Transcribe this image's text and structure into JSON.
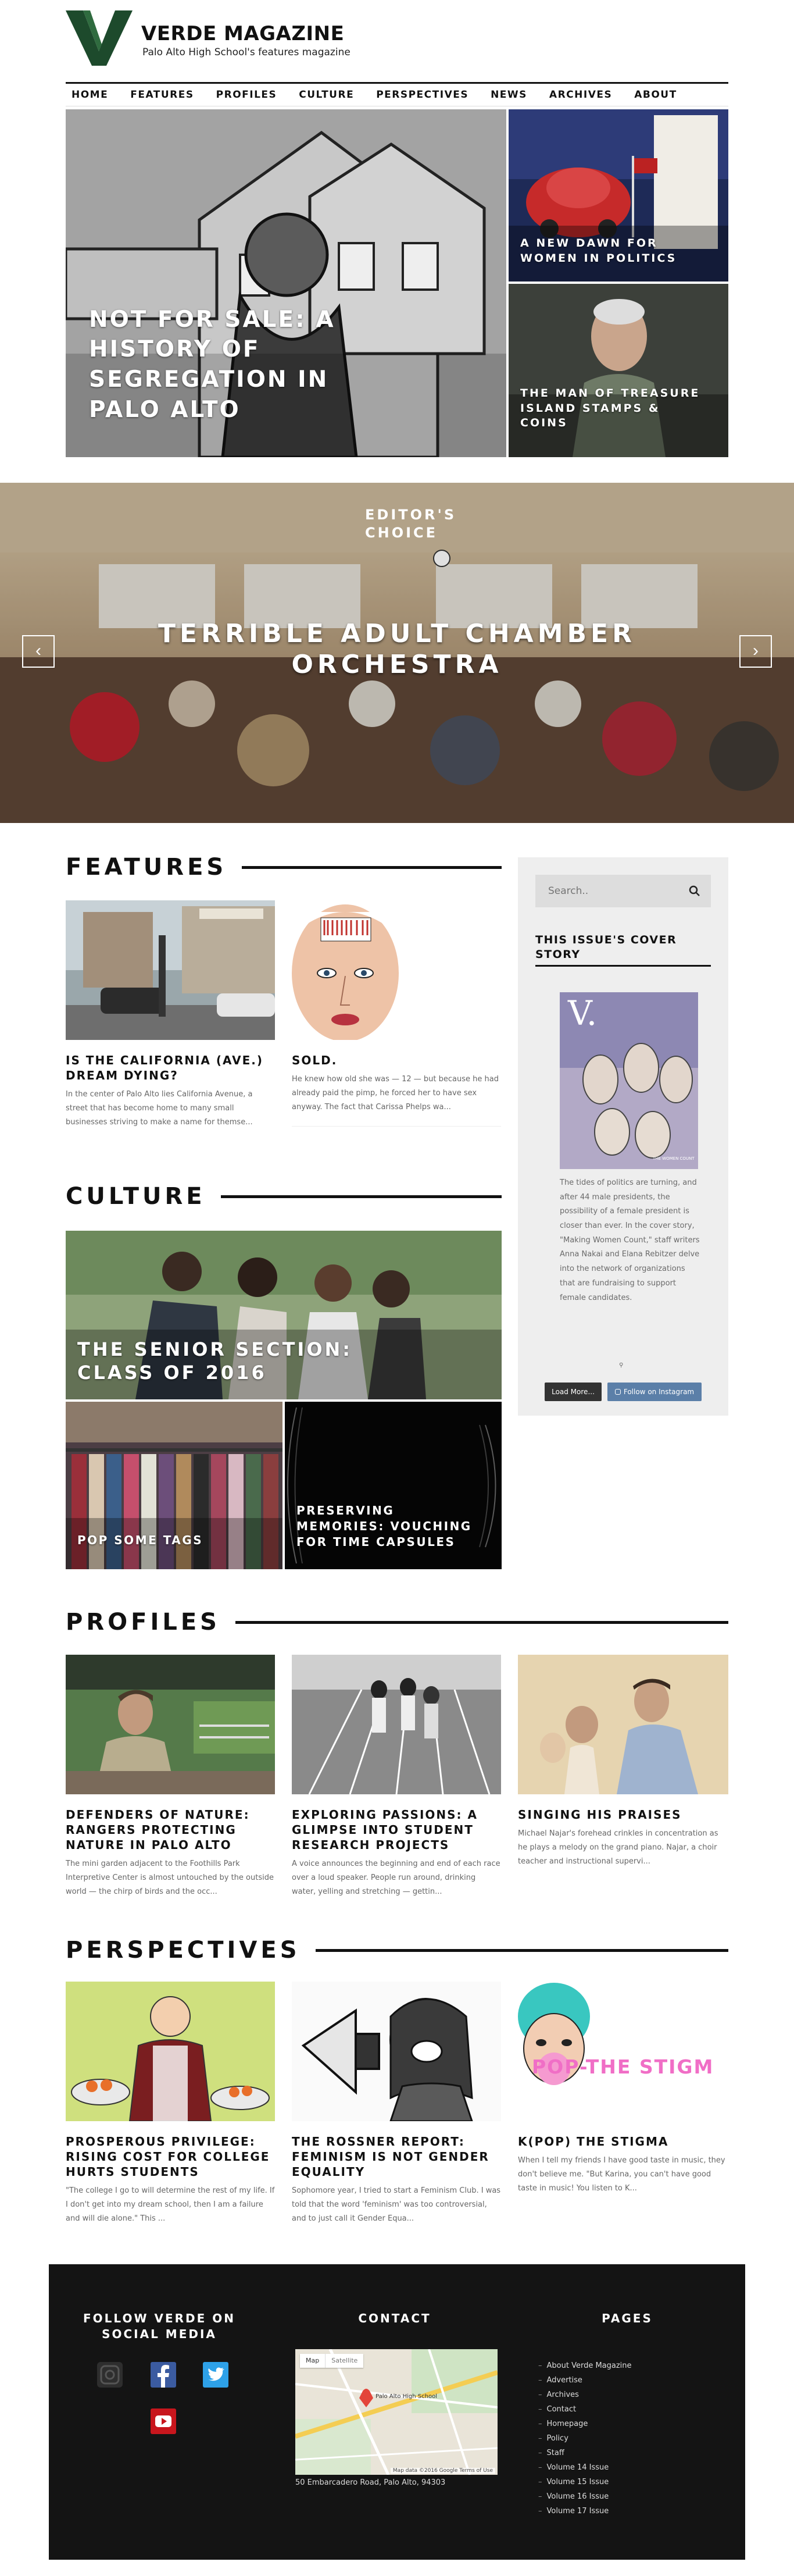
{
  "site": {
    "title": "VERDE MAGAZINE",
    "tagline": "Palo Alto High School's features magazine",
    "logo_letter": "V",
    "brand_color": "#1d4a2c"
  },
  "nav": [
    "HOME",
    "FEATURES",
    "PROFILES",
    "CULTURE",
    "PERSPECTIVES",
    "NEWS",
    "ARCHIVES",
    "ABOUT"
  ],
  "hero": {
    "main_title": "NOT FOR SALE: A HISTORY OF SEGREGATION IN PALO ALTO",
    "right_top_title": "A NEW DAWN FOR WOMEN IN POLITICS",
    "right_bottom_title": "THE MAN OF TREASURE ISLAND STAMPS & COINS"
  },
  "editors_choice": {
    "kicker": "EDITOR'S CHOICE",
    "title": "TERRIBLE ADULT CHAMBER ORCHESTRA",
    "prev": "‹",
    "next": "›"
  },
  "features": {
    "heading": "FEATURES",
    "items": [
      {
        "title": "IS THE CALIFORNIA (AVE.) DREAM DYING?",
        "excerpt": "In the center of Palo Alto lies California Avenue, a street that has become home to many small businesses striving to make a name for themse..."
      },
      {
        "title": "SOLD.",
        "excerpt": "He knew how old she was — 12 — but because he had already paid the pimp, he forced her to have sex anyway. The fact that Carissa Phelps wa..."
      }
    ]
  },
  "sidebar": {
    "search_placeholder": "Search..",
    "cover_heading": "THIS ISSUE'S COVER STORY",
    "cover_letter": "V.",
    "cover_caption": "THE WOMEN COUNT",
    "cover_text": "The tides of politics are turning, and after 44 male presidents, the possibility of a female president is closer than ever. In the cover story, \"Making Women Count,\" staff writers Anna Nakai and Elana Rebitzer delve into the network of organizations that are fundraising to support female candidates.",
    "load_more": "Load More...",
    "follow_instagram": "Follow on Instagram"
  },
  "culture": {
    "heading": "CULTURE",
    "main_title": "THE SENIOR SECTION: CLASS OF 2016",
    "left_title": "POP SOME TAGS",
    "right_title": "PRESERVING MEMORIES: VOUCHING FOR TIME CAPSULES"
  },
  "profiles": {
    "heading": "PROFILES",
    "items": [
      {
        "title": "DEFENDERS OF NATURE: RANGERS PROTECTING NATURE IN PALO ALTO",
        "excerpt": "The mini garden adjacent to the Foothills Park Interpretive Center is almost untouched by the outside world — the chirp of birds and the occ..."
      },
      {
        "title": "EXPLORING PASSIONS: A GLIMPSE INTO STUDENT RESEARCH PROJECTS",
        "excerpt": "A voice announces the beginning and end of each race over a loud speaker. People run around, drinking water, yelling and stretching — gettin..."
      },
      {
        "title": "SINGING HIS PRAISES",
        "excerpt": "Michael Najar's forehead crinkles in concentration as he plays a melody on the grand piano. Najar, a choir teacher and instructional supervi..."
      }
    ]
  },
  "perspectives": {
    "heading": "PERSPECTIVES",
    "items": [
      {
        "title": "PROSPEROUS PRIVILEGE: RISING COST FOR COLLEGE HURTS STUDENTS",
        "excerpt": "\"The college I go to will determine the rest of my life. If I don't get into my dream school, then I am a failure and will die alone.\" This ..."
      },
      {
        "title": "THE ROSSNER REPORT: FEMINISM IS NOT GENDER EQUALITY",
        "excerpt": "Sophomore year, I tried to start a Feminism Club. I was told that the word 'feminism' was too controversial, and to just call it Gender Equa..."
      },
      {
        "title": "K(POP) THE STIGMA",
        "excerpt": "When I tell my friends I have good taste in music, they don't believe me. \"But Karina, you can't have good taste in music! You listen to K...",
        "art_text": "POP-THE STIGM"
      }
    ]
  },
  "footer": {
    "social_title": "FOLLOW VERDE ON SOCIAL MEDIA",
    "contact_title": "CONTACT",
    "pages_title": "PAGES",
    "map_tabs": [
      "Map",
      "Satellite"
    ],
    "map_school_label": "Palo Alto High School",
    "map_credit": "Map data ©2016 Google  Terms of Use",
    "address": "50 Embarcadero Road, Palo Alto, 94303",
    "pages": [
      "About Verde Magazine",
      "Advertise",
      "Archives",
      "Contact",
      "Homepage",
      "Policy",
      "Staff",
      "Volume 14 Issue",
      "Volume 15 Issue",
      "Volume 16 Issue",
      "Volume 17 Issue"
    ]
  }
}
